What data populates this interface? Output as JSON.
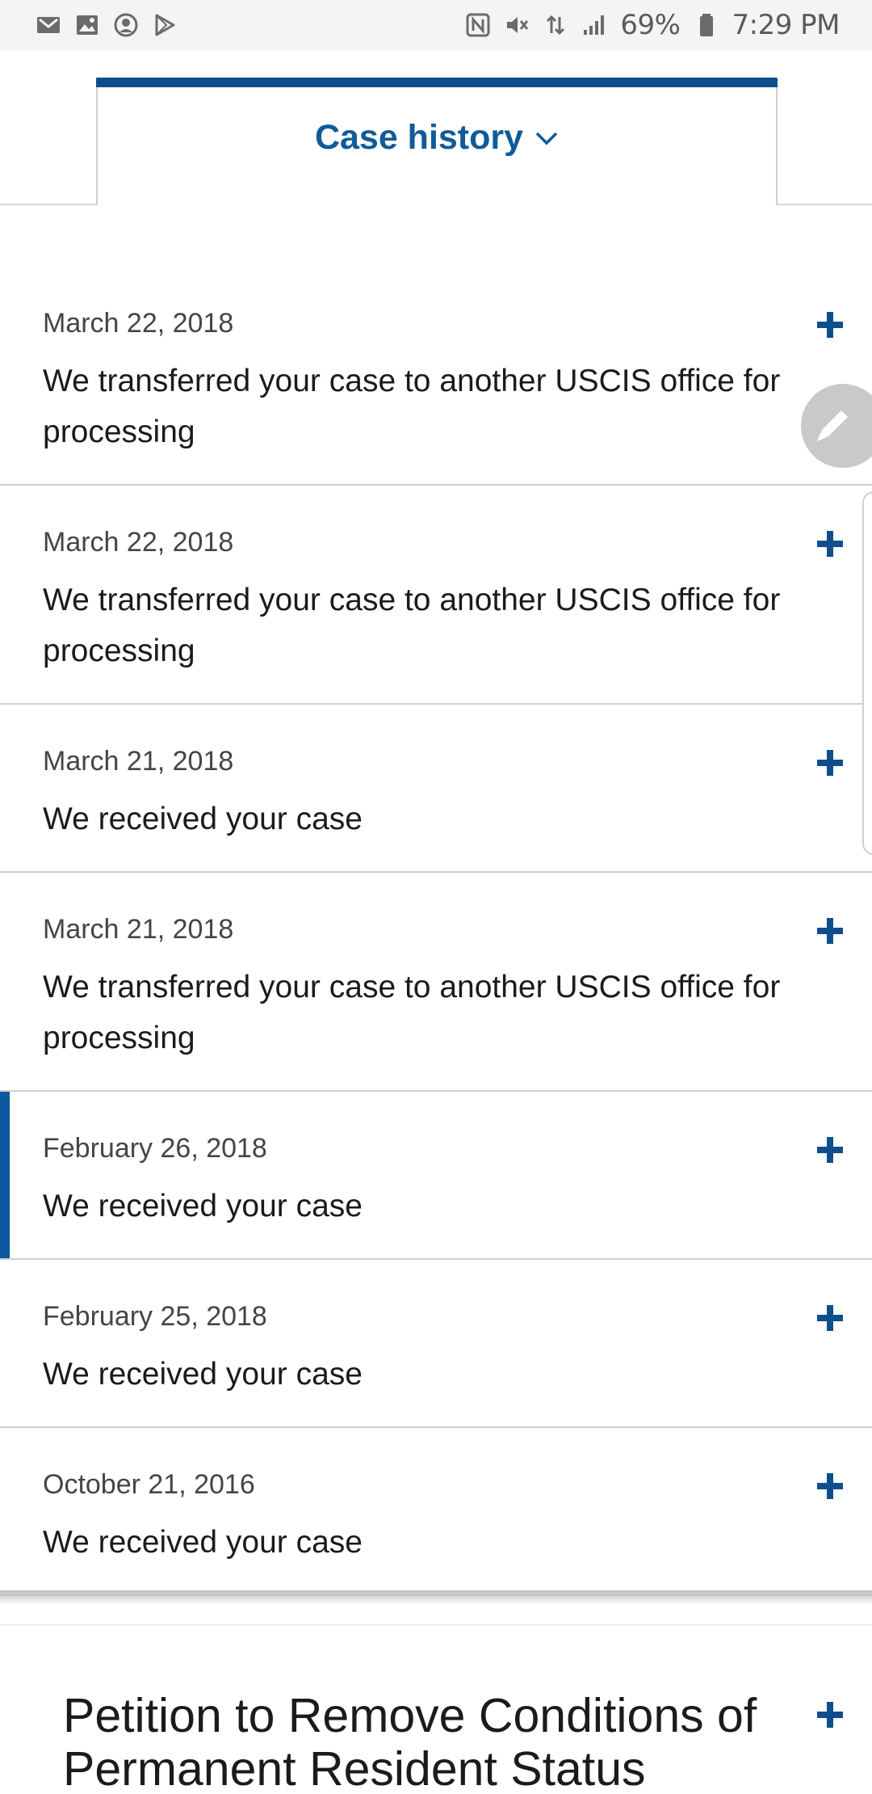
{
  "status_bar": {
    "battery": "69%",
    "time": "7:29 PM",
    "icons_left": [
      "gmail-icon",
      "gallery-icon",
      "account-icon",
      "play-store-icon"
    ],
    "icons_right": [
      "nfc-icon",
      "mute-icon",
      "data-icon",
      "signal-icon",
      "battery-icon"
    ]
  },
  "tab": {
    "label": "Case history",
    "accent_color": "#0f4e8c"
  },
  "history": {
    "items": [
      {
        "date": "March 22, 2018",
        "text": "We transferred your case to another USCIS office for processing"
      },
      {
        "date": "March 22, 2018",
        "text": "We transferred your case to another USCIS office for processing"
      },
      {
        "date": "March 21, 2018",
        "text": "We received your case"
      },
      {
        "date": "March 21, 2018",
        "text": "We transferred your case to another USCIS office for processing"
      },
      {
        "date": "February 26, 2018",
        "text": "We received your case"
      },
      {
        "date": "February 25, 2018",
        "text": "We received your case"
      },
      {
        "date": "October 21, 2016",
        "text": "We received your case"
      }
    ]
  },
  "section": {
    "title": "Petition to Remove Conditions of Permanent Resident Status"
  }
}
